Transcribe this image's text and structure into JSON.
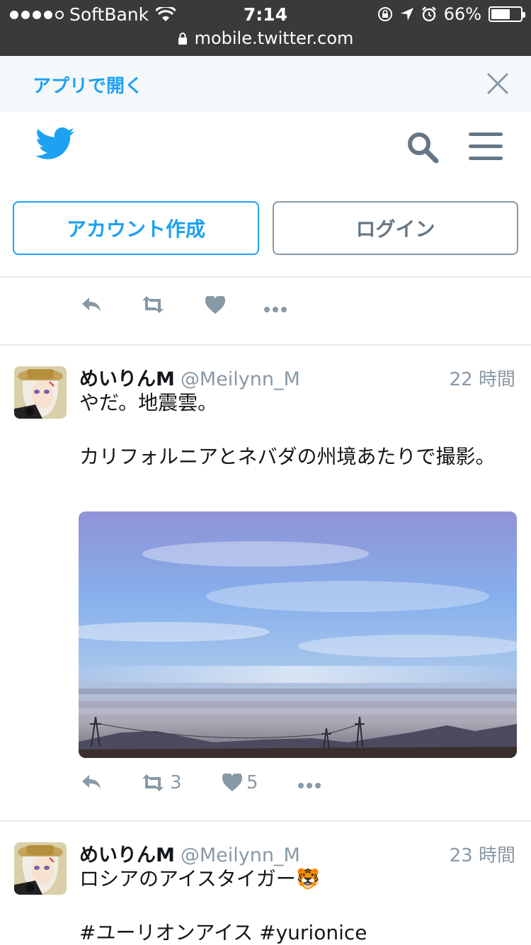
{
  "status_bar": {
    "carrier": "SoftBank",
    "time": "7:14",
    "battery": "66%",
    "battery_level": 0.66,
    "url": "mobile.twitter.com",
    "signal_bars": 4
  },
  "banner": {
    "open_app_label": "アプリで開く"
  },
  "header": {
    "logo_icon": "twitter-bird-icon",
    "search_icon": "search-icon",
    "menu_icon": "hamburger-menu-icon"
  },
  "auth": {
    "signup_label": "アカウント作成",
    "login_label": "ログイン"
  },
  "colors": {
    "brand": "#1da1f2",
    "muted": "#8899a6",
    "status_bar": "#3a3a3a"
  },
  "tweets": [
    {
      "name": "めいりんM",
      "handle": "@Meilynn_M",
      "time": "22 時間",
      "text": "やだ。地震雲。\n\nカリフォルニアとネバダの州境あたりで撮影。",
      "retweets": "3",
      "likes": "5"
    },
    {
      "name": "めいりんM",
      "handle": "@Meilynn_M",
      "time": "23 時間",
      "text": "ロシアのアイスタイガー🐯\n\n#ユーリオンアイス #yurionice"
    }
  ]
}
